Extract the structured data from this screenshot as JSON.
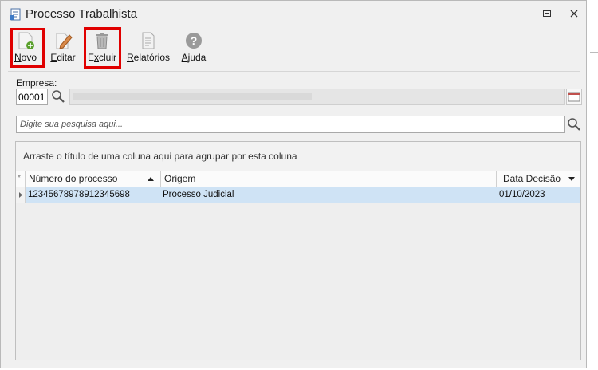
{
  "window": {
    "title": "Processo Trabalhista"
  },
  "toolbar": {
    "novo": {
      "pre": "",
      "u": "N",
      "post": "ovo"
    },
    "editar": {
      "pre": "",
      "u": "E",
      "post": "ditar"
    },
    "excluir": {
      "pre": "E",
      "u": "x",
      "post": "cluir"
    },
    "relatorios": {
      "pre": "",
      "u": "R",
      "post": "elatórios"
    },
    "ajuda": {
      "pre": "",
      "u": "A",
      "post": "juda"
    }
  },
  "empresa": {
    "label": "Empresa:",
    "code": "00001",
    "name": ""
  },
  "search": {
    "placeholder": "Digite sua pesquisa aqui..."
  },
  "grid": {
    "group_hint": "Arraste o título de uma coluna aqui para agrupar por esta coluna",
    "columns": [
      "Número do processo",
      "Origem",
      "Data Decisão"
    ],
    "rows": [
      {
        "numero": "12345678978912345698",
        "origem": "Processo Judicial",
        "data": "01/10/2023"
      }
    ]
  },
  "colors": {
    "highlight": "#e00000",
    "selected_row": "#cfe3f5"
  },
  "icons": [
    "document-icon",
    "new-file-icon",
    "edit-icon",
    "trash-icon",
    "report-icon",
    "help-icon",
    "search-icon",
    "calculator-icon"
  ]
}
